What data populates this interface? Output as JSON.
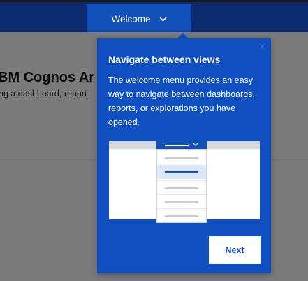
{
  "header": {
    "welcome_label": "Welcome",
    "welcome_icon": "chevron-down-icon"
  },
  "main": {
    "title": "BM Cognos Ar",
    "subtitle": "ng a dashboard, report"
  },
  "popover": {
    "title": "Navigate between views",
    "body": "The welcome menu provides an easy way to navigate between dashboards, reports, or explorations you have opened.",
    "close_icon": "close-icon",
    "next_label": "Next",
    "illustration": {
      "menu_items": 5,
      "active_item_index": 1
    }
  },
  "colors": {
    "topbar": "#0c2a6e",
    "accent": "#1050b8",
    "popover": "#0f4fc0",
    "overlay": "#7a7a7a"
  }
}
